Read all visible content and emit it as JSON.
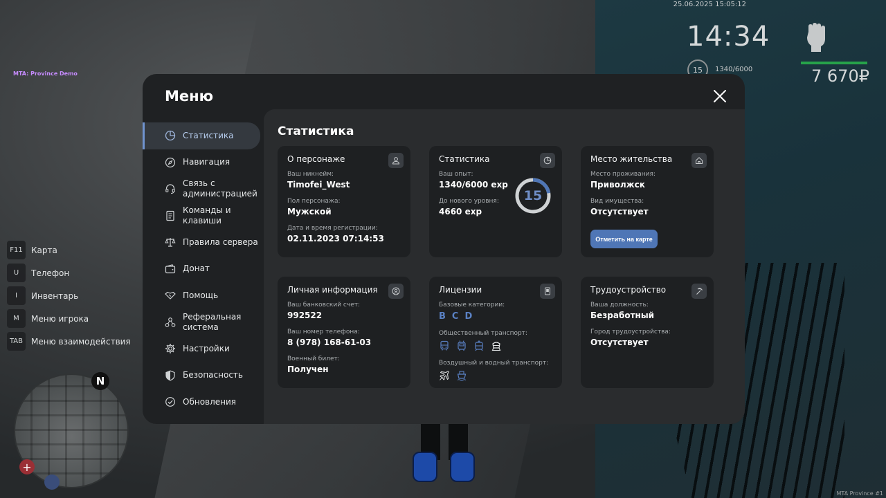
{
  "hud": {
    "server_name": "MTA: Province Demo",
    "datetime": "25.06.2025 15:05:12",
    "clock": "14:34",
    "level": "15",
    "exp": "1340/6000",
    "money": "7 670₽",
    "brand": "MTA Province #1"
  },
  "keybinds": [
    {
      "key": "F11",
      "label": "Карта"
    },
    {
      "key": "U",
      "label": "Телефон"
    },
    {
      "key": "I",
      "label": "Инвентарь"
    },
    {
      "key": "M",
      "label": "Меню игрока"
    },
    {
      "key": "TAB",
      "label": "Меню взаимодействия"
    }
  ],
  "minimap": {
    "north_label": "N",
    "health_icon": "plus-icon",
    "notify_icon": "bell-icon"
  },
  "menu": {
    "title": "Меню",
    "nav": [
      {
        "label": "Статистика",
        "icon": "pie-chart-icon",
        "active": true
      },
      {
        "label": "Навигация",
        "icon": "compass-icon",
        "active": false
      },
      {
        "label": "Связь с администрацией",
        "icon": "headset-icon",
        "active": false
      },
      {
        "label": "Команды и клавиши",
        "icon": "document-icon",
        "active": false
      },
      {
        "label": "Правила сервера",
        "icon": "scales-icon",
        "active": false
      },
      {
        "label": "Донат",
        "icon": "wallet-icon",
        "active": false
      },
      {
        "label": "Помощь",
        "icon": "handshake-icon",
        "active": false
      },
      {
        "label": "Реферальная система",
        "icon": "network-icon",
        "active": false
      },
      {
        "label": "Настройки",
        "icon": "gear-icon",
        "active": false
      },
      {
        "label": "Безопасность",
        "icon": "shield-icon",
        "active": false
      },
      {
        "label": "Обновления",
        "icon": "refresh-icon",
        "active": false
      }
    ],
    "content_title": "Статистика",
    "cards": {
      "character": {
        "title": "О персонаже",
        "nickname_label": "Ваш никнейм:",
        "nickname": "Timofei_West",
        "gender_label": "Пол персонажа:",
        "gender": "Мужской",
        "reg_label": "Дата и время регистрации:",
        "reg": "02.11.2023 07:14:53"
      },
      "stats": {
        "title": "Статистика",
        "exp_label": "Ваш опыт:",
        "exp": "1340/6000 exp",
        "next_label": "До нового уровня:",
        "next": "4660 exp",
        "level": "15",
        "progress": 0.2233
      },
      "residence": {
        "title": "Место жительства",
        "place_label": "Место проживания:",
        "place": "Приволжск",
        "property_label": "Вид имущества:",
        "property": "Отсутствует",
        "button": "Отметить на карте"
      },
      "personal": {
        "title": "Личная информация",
        "bank_label": "Ваш банковский счет:",
        "bank": "992522",
        "phone_label": "Ваш номер телефона:",
        "phone": "8 (978) 168-61-03",
        "military_label": "Военный билет:",
        "military": "Получен"
      },
      "licenses": {
        "title": "Лицензии",
        "basic_label": "Базовые категории:",
        "basic": [
          "B",
          "C",
          "D"
        ],
        "public_label": "Общественный транспорт:",
        "public_icons": [
          "bus-icon",
          "trolleybus-icon",
          "tram-icon",
          "train-icon"
        ],
        "air_label": "Воздушный и водный транспорт:",
        "air_icons": [
          "plane-icon",
          "boat-icon"
        ]
      },
      "job": {
        "title": "Трудоустройство",
        "position_label": "Ваша должность:",
        "position": "Безработный",
        "city_label": "Город трудоустройства:",
        "city": "Отсутствует"
      }
    }
  },
  "colors": {
    "accent": "#4f76b6",
    "active_nav": "#34393f",
    "license_active": "#5a81c4",
    "hud_bar": "#27a24a"
  }
}
